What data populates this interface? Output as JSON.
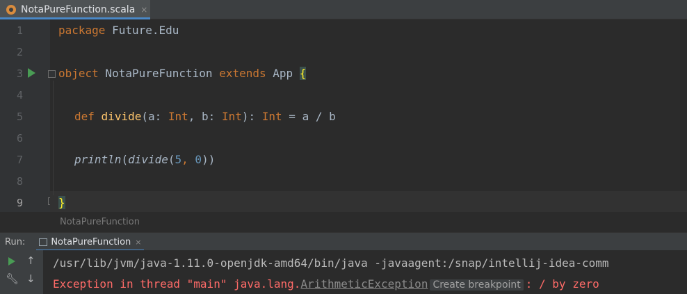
{
  "editor_tab": {
    "title": "NotaPureFunction.scala",
    "close": "×"
  },
  "gutter": {
    "line_numbers": [
      "1",
      "2",
      "3",
      "4",
      "5",
      "6",
      "7",
      "8",
      "9"
    ]
  },
  "code": {
    "l1": {
      "kw": "package",
      "rest": " Future.Edu"
    },
    "l3": {
      "kw1": "object",
      "name": " NotaPureFunction ",
      "kw2": "extends",
      "app": " App ",
      "brace": "{"
    },
    "l5": {
      "kw": "def",
      "fn": "divide",
      "p1": "(a: ",
      "t1": "Int",
      "p2": ", b: ",
      "t2": "Int",
      "p3": "): ",
      "t3": "Int",
      "p4": " = a / b"
    },
    "l7": {
      "call": "println",
      "p1": "(",
      "inner": "divide",
      "p2": "(",
      "n1": "5",
      "comma": ", ",
      "n2": "0",
      "p3": "))"
    },
    "l9": {
      "brace": "}"
    }
  },
  "breadcrumb": "NotaPureFunction",
  "run_panel": {
    "label": "Run:",
    "tab_title": "NotaPureFunction",
    "tab_close": "×",
    "icons": [
      "rerun-icon",
      "wrench-icon",
      "up-arrow-icon",
      "down-arrow-icon"
    ],
    "output": {
      "command": "/usr/lib/jvm/java-1.11.0-openjdk-amd64/bin/java -javaagent:/snap/intellij-idea-comm",
      "error_prefix": "Exception in thread \"main\" java.lang.",
      "error_class": "ArithmeticException",
      "breakpoint_chip": "Create breakpoint",
      "error_suffix": ": / by zero"
    }
  },
  "colors": {
    "keyword": "#cc7832",
    "function": "#ffc66d",
    "number": "#6897bb",
    "error": "#ff6b68",
    "accent": "#4a88c7"
  }
}
